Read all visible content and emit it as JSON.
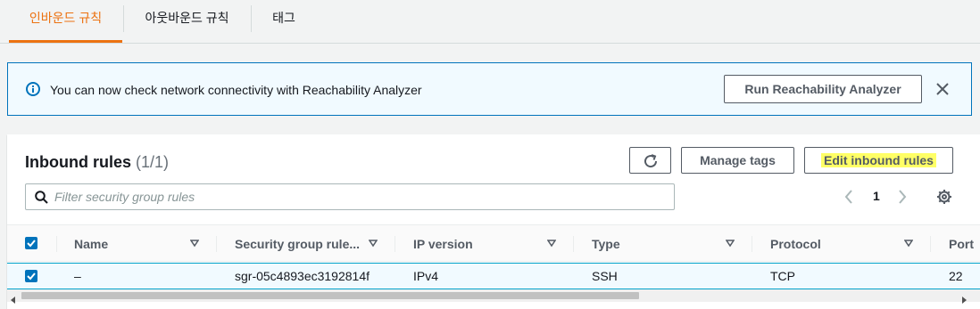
{
  "tabs": [
    {
      "label": "인바운드 규칙",
      "active": true
    },
    {
      "label": "아웃바운드 규칙",
      "active": false
    },
    {
      "label": "태그",
      "active": false
    }
  ],
  "flash": {
    "message": "You can now check network connectivity with Reachability Analyzer",
    "button_label": "Run Reachability Analyzer",
    "icon": "info-icon",
    "close_icon": "close-icon"
  },
  "panel": {
    "title": "Inbound rules",
    "count": "(1/1)",
    "refresh_icon": "refresh-icon",
    "manage_tags_label": "Manage tags",
    "edit_rules_label": "Edit inbound rules"
  },
  "search": {
    "placeholder": "Filter security group rules",
    "value": ""
  },
  "pagination": {
    "current_page": "1"
  },
  "table": {
    "columns": [
      "Name",
      "Security group rule...",
      "IP version",
      "Type",
      "Protocol",
      "Port"
    ],
    "rows": [
      {
        "selected": true,
        "name": "–",
        "rule_id": "sgr-05c4893ec3192814f",
        "ip_version": "IPv4",
        "type": "SSH",
        "protocol": "TCP",
        "port": "22"
      }
    ]
  },
  "colors": {
    "accent": "#ec7211",
    "link_blue": "#0073bb",
    "highlight": "#ffff66"
  }
}
